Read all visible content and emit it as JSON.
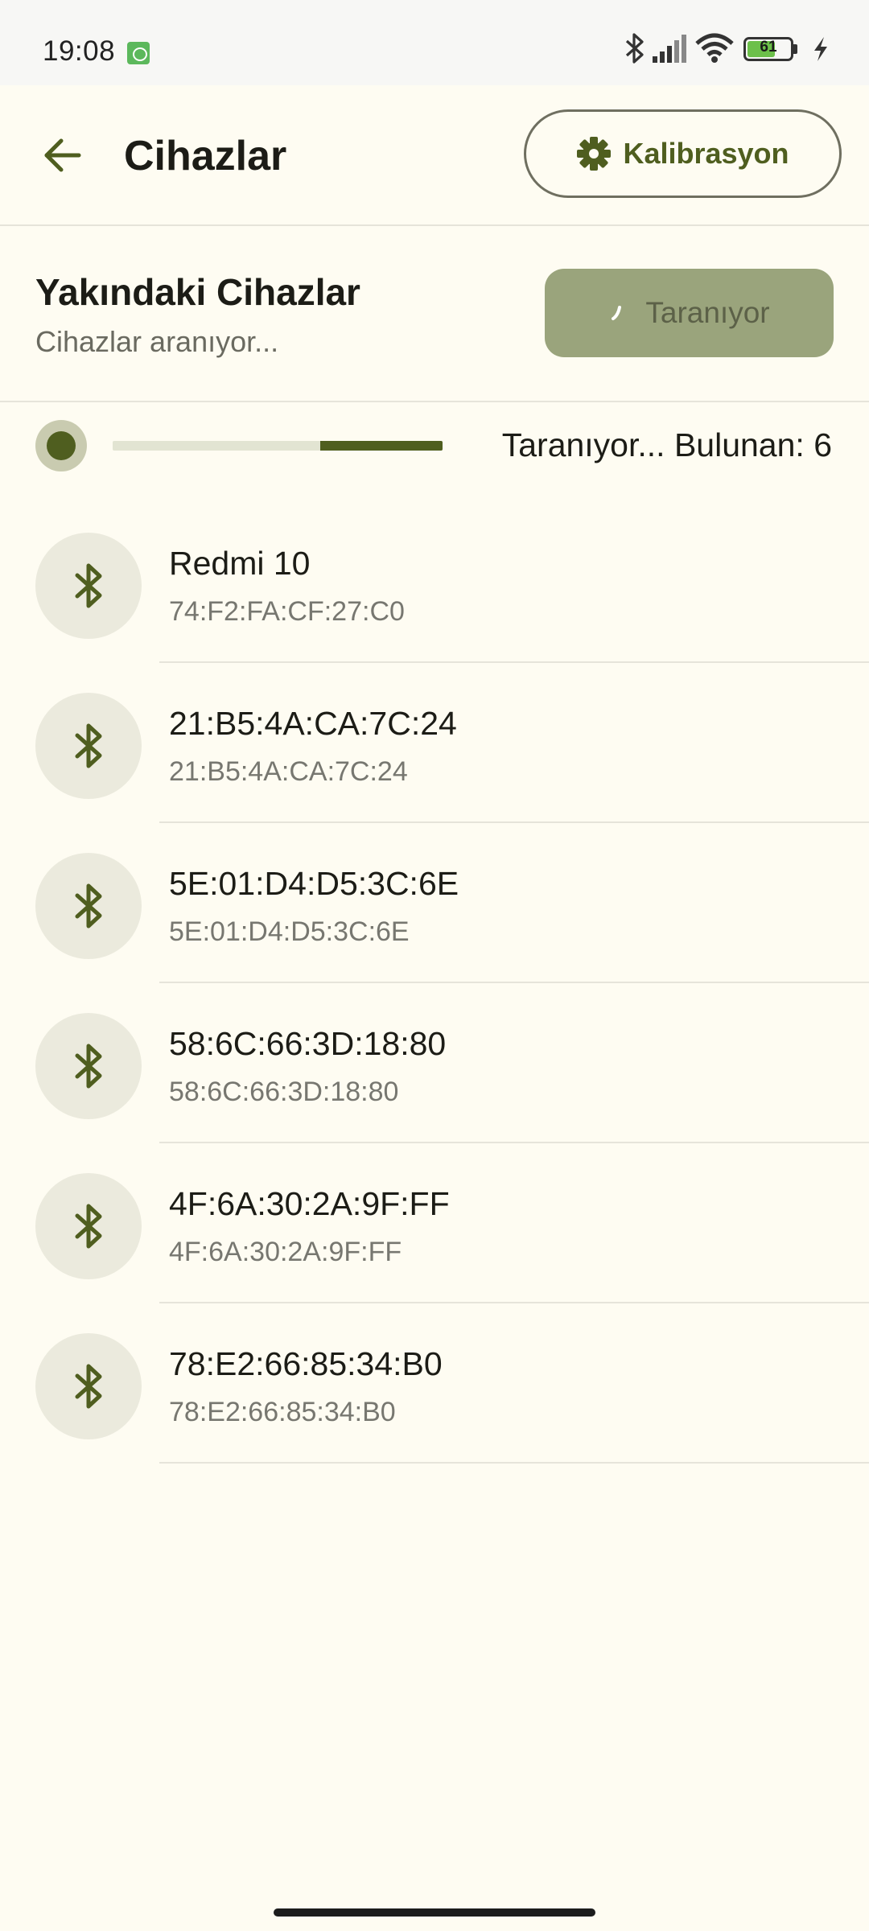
{
  "status_bar": {
    "time": "19:08",
    "battery_level": "61",
    "icons": [
      "android-notification-icon",
      "bluetooth-icon",
      "signal-icon",
      "wifi-icon",
      "battery-icon",
      "charging-icon"
    ]
  },
  "header": {
    "title": "Cihazlar",
    "back_icon": "arrow-back-icon",
    "calibration_label": "Kalibrasyon",
    "calibration_icon": "gear-icon"
  },
  "nearby": {
    "title": "Yakındaki Cihazlar",
    "subtitle": "Cihazlar aranıyor...",
    "scan_button_label": "Taranıyor"
  },
  "scan_progress": {
    "text": "Taranıyor... Bulunan: 6",
    "fill_start_fraction": 0.63,
    "fill_end_fraction": 1.0
  },
  "devices": [
    {
      "name": "Redmi 10",
      "mac": "74:F2:FA:CF:27:C0",
      "icon": "bluetooth-icon"
    },
    {
      "name": "21:B5:4A:CA:7C:24",
      "mac": "21:B5:4A:CA:7C:24",
      "icon": "bluetooth-icon"
    },
    {
      "name": "5E:01:D4:D5:3C:6E",
      "mac": "5E:01:D4:D5:3C:6E",
      "icon": "bluetooth-icon"
    },
    {
      "name": "58:6C:66:3D:18:80",
      "mac": "58:6C:66:3D:18:80",
      "icon": "bluetooth-icon"
    },
    {
      "name": "4F:6A:30:2A:9F:FF",
      "mac": "4F:6A:30:2A:9F:FF",
      "icon": "bluetooth-icon"
    },
    {
      "name": "78:E2:66:85:34:B0",
      "mac": "78:E2:66:85:34:B0",
      "icon": "bluetooth-icon"
    }
  ],
  "colors": {
    "accent": "#4f5e1f",
    "background": "#fefcf2",
    "scan_button": "#9aa47c",
    "avatar_bg": "#ebeadd"
  }
}
